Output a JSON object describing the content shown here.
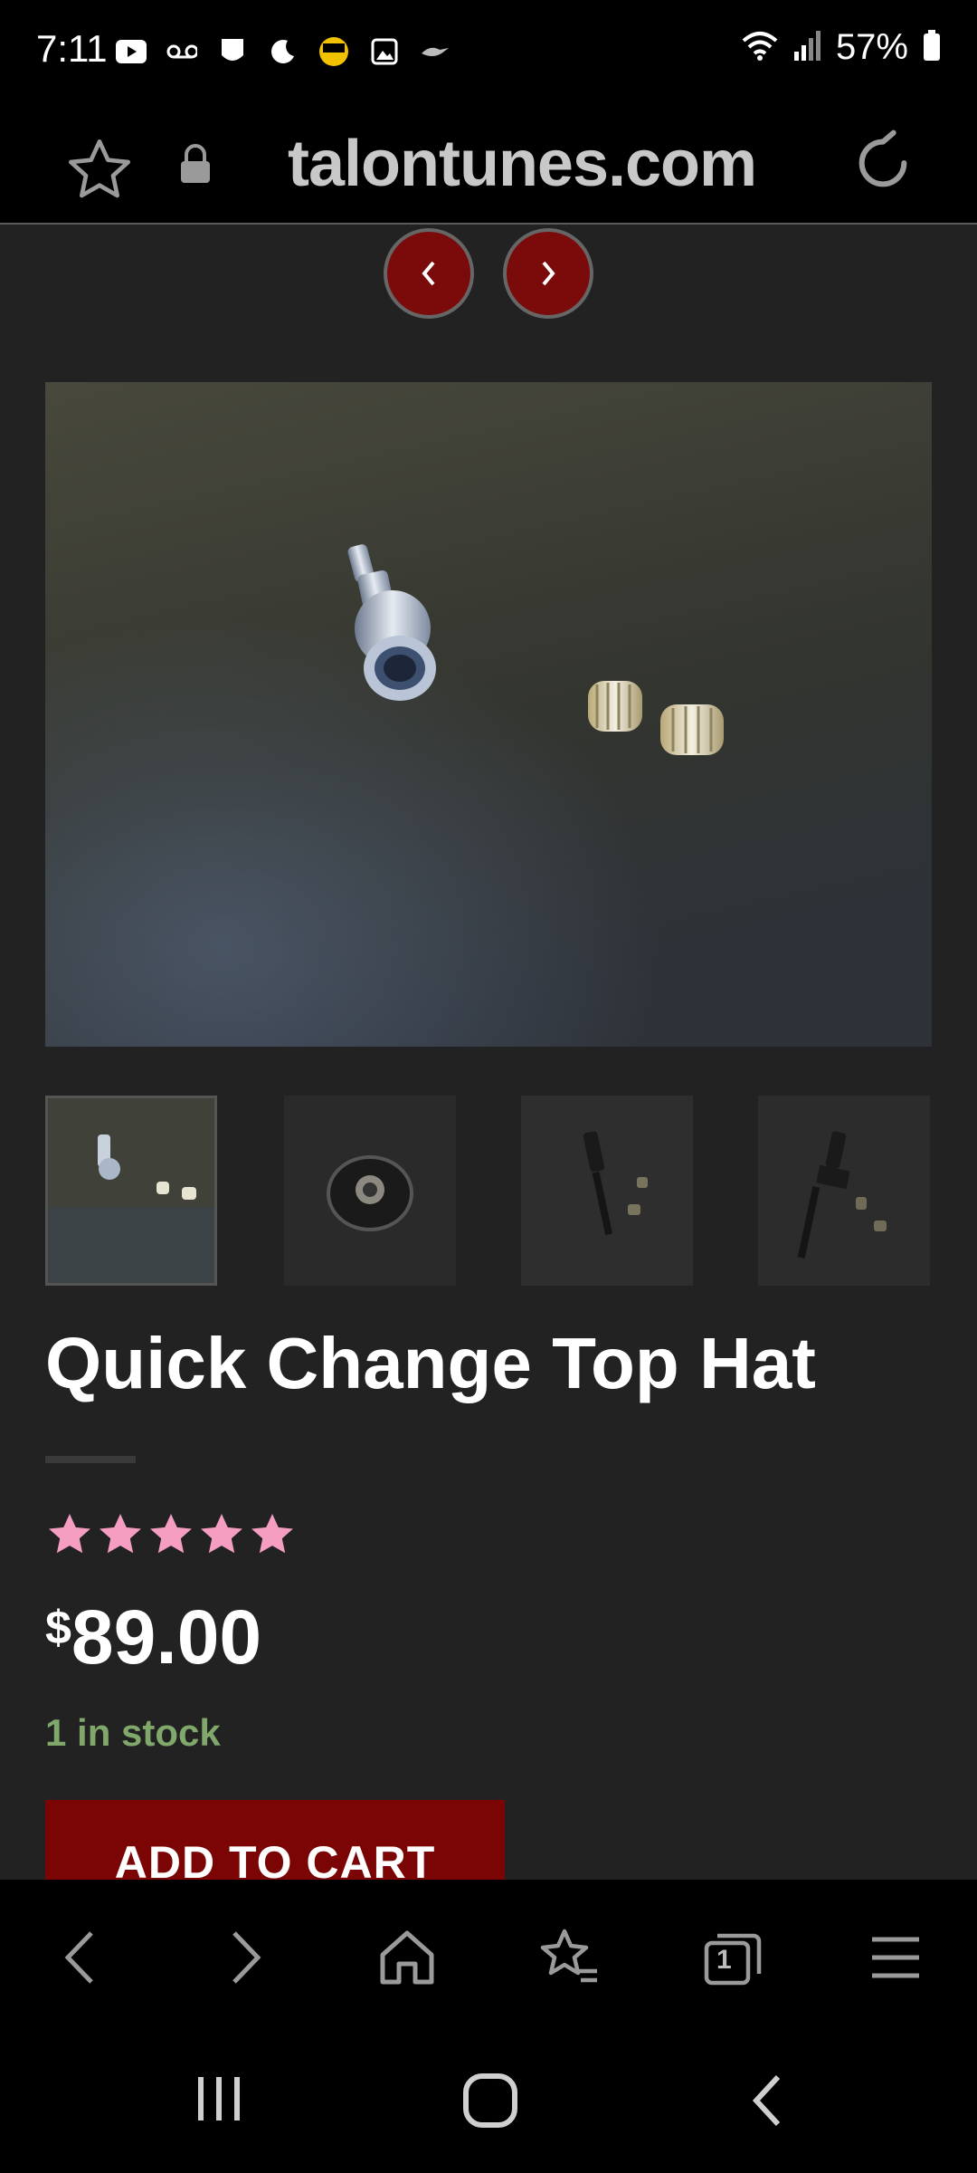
{
  "status_bar": {
    "time": "7:11",
    "battery": "57%",
    "notification_icons": [
      "youtube-icon",
      "voicemail-icon",
      "nfl-icon",
      "moon-icon",
      "fox-bet-icon",
      "gallery-icon",
      "ravens-icon"
    ]
  },
  "browser": {
    "domain": "talontunes.com",
    "tab_count": "1"
  },
  "product": {
    "title": "Quick Change Top Hat",
    "rating": 5,
    "rating_max": 5,
    "currency_symbol": "$",
    "price": "89.00",
    "stock": "1 in stock",
    "add_to_cart": "ADD TO CART",
    "thumbnail_count": 4
  },
  "colors": {
    "background": "#222222",
    "accent_red": "#7b0505",
    "star_pink": "#f59ec2",
    "stock_green": "#7fa86a"
  }
}
